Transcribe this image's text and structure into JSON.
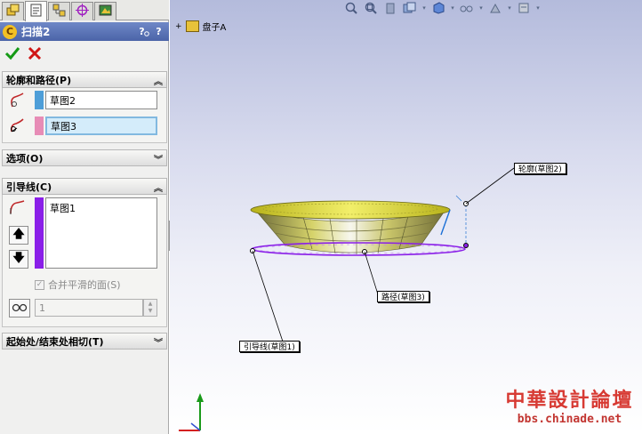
{
  "property_manager": {
    "tabs": [
      {
        "icon": "feature-manager-icon"
      },
      {
        "icon": "property-manager-icon"
      },
      {
        "icon": "configuration-manager-icon"
      },
      {
        "icon": "origin-icon"
      },
      {
        "icon": "display-manager-icon"
      }
    ],
    "feature": {
      "title": "扫描2",
      "icon": "sweep-icon",
      "help_label": "?",
      "help_icon": "glasses-icon"
    },
    "profile_path": {
      "header": "轮廓和路径(P)",
      "profile_value": "草图2",
      "path_value": "草图3",
      "profile_color": "#4e9ed8",
      "path_color": "#e78cb6"
    },
    "options": {
      "header": "选项(O)"
    },
    "guide_curves": {
      "header": "引导线(C)",
      "items": [
        "草图1"
      ],
      "color": "#8a1fe8",
      "merge_smooth_faces_label": "合并平滑的面(S)",
      "merge_smooth_faces_checked": true,
      "count_value": "1"
    },
    "tangency": {
      "header": "起始处/结束处相切(T)"
    }
  },
  "viewport": {
    "tree_label": "盘子A",
    "callouts": {
      "profile": "轮廓(草图2)",
      "path": "路径(草图3)",
      "guide": "引导线(草图1)"
    },
    "watermark": {
      "title": "中華設計論壇",
      "url": "bbs.chinade.net"
    },
    "colors": {
      "dish_yellow": "#d8d323",
      "path_purple": "#8a1fe8",
      "axis_y": "#1a9a1a",
      "axis_x": "#d42020"
    }
  }
}
